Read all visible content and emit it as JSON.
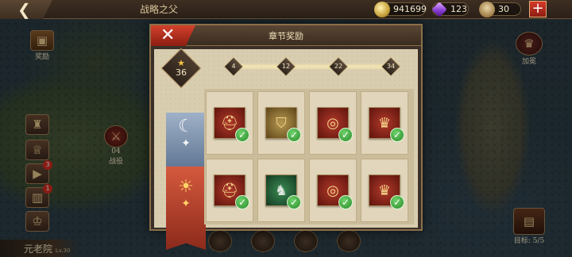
{
  "top_bar": {
    "back_icon": "back-arrow-icon",
    "title": "战略之父",
    "resources": [
      {
        "name": "gold",
        "icon": "gold-coin-icon",
        "value": "941699"
      },
      {
        "name": "gem",
        "icon": "gem-icon",
        "value": "123"
      },
      {
        "name": "other",
        "icon": "helmet-token-icon",
        "value": "30"
      }
    ],
    "plus_label": "+"
  },
  "side": {
    "reward_label": "奖励",
    "crown_label": "加冕",
    "battle_label": "战役",
    "battle_level": "04",
    "task_label": "目标: 5/5",
    "badge_video": "3",
    "badge_chest": "1"
  },
  "bottom": {
    "senate_label": "元老院",
    "senate_level": "Lv.30"
  },
  "panel": {
    "title": "章节奖励",
    "close_label": "✕",
    "stars": "36",
    "star_glyph": "★",
    "milestones": [
      "4",
      "12",
      "22",
      "34"
    ],
    "colors": {
      "accent_red": "#c8392a",
      "check_green": "#3aa63a",
      "panel_paper": "#d9cdb0"
    },
    "rows": [
      {
        "tier": "silver",
        "items": [
          {
            "icon": "warrior-helmet-icon",
            "rarity": "red",
            "claimed": true
          },
          {
            "icon": "golden-shield-icon",
            "rarity": "gold",
            "claimed": true
          },
          {
            "icon": "ring-icon",
            "rarity": "red",
            "claimed": true
          },
          {
            "icon": "crown-icon",
            "rarity": "red",
            "claimed": true
          }
        ]
      },
      {
        "tier": "gold",
        "items": [
          {
            "icon": "warrior-helmet-icon",
            "rarity": "red",
            "claimed": true
          },
          {
            "icon": "knight-armor-icon",
            "rarity": "green",
            "claimed": true
          },
          {
            "icon": "ring-icon",
            "rarity": "red",
            "claimed": true
          },
          {
            "icon": "crown-icon",
            "rarity": "red",
            "claimed": true
          }
        ]
      }
    ]
  }
}
